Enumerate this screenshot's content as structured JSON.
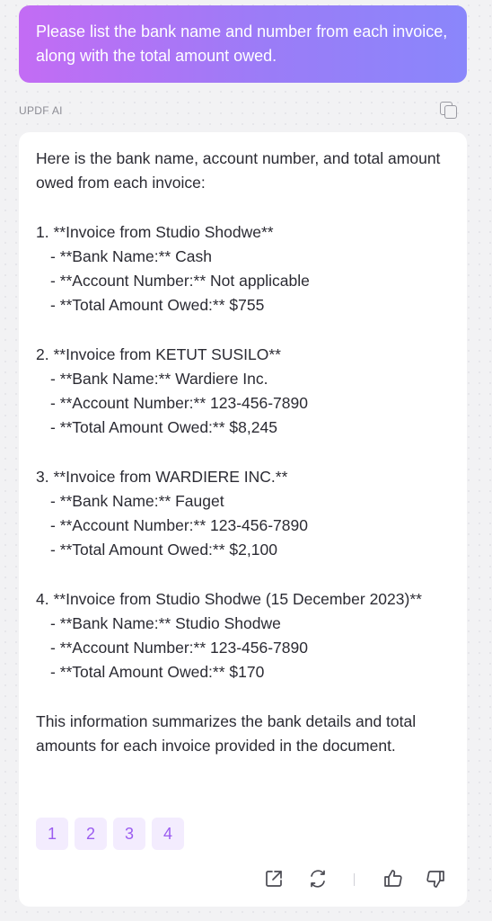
{
  "user_message": "Please list the bank name and number from each invoice, along with the total amount owed.",
  "ai_label": "UPDF AI",
  "answer": {
    "intro": "Here is the bank name, account number, and total amount owed from each invoice:",
    "items": [
      {
        "heading": "1. **Invoice from Studio Shodwe**",
        "lines": [
          "- **Bank Name:** Cash",
          "- **Account Number:** Not applicable",
          "- **Total Amount Owed:** $755"
        ]
      },
      {
        "heading": "2. **Invoice from KETUT SUSILO**",
        "lines": [
          "- **Bank Name:** Wardiere Inc.",
          "- **Account Number:** 123-456-7890",
          "- **Total Amount Owed:** $8,245"
        ]
      },
      {
        "heading": "3. **Invoice from WARDIERE INC.**",
        "lines": [
          "- **Bank Name:** Fauget",
          "- **Account Number:** 123-456-7890",
          "- **Total Amount Owed:** $2,100"
        ]
      },
      {
        "heading": "4. **Invoice from Studio Shodwe (15 December 2023)**",
        "lines": [
          "- **Bank Name:** Studio Shodwe",
          "- **Account Number:** 123-456-7890",
          "- **Total Amount Owed:** $170"
        ]
      }
    ],
    "summary": "This information summarizes the bank details and total amounts for each invoice provided in the document."
  },
  "references": [
    "1",
    "2",
    "3",
    "4"
  ],
  "icons": {
    "copy": "copy-icon",
    "export": "export-icon",
    "regenerate": "regenerate-icon",
    "like": "thumbs-up-icon",
    "dislike": "thumbs-down-icon"
  },
  "colors": {
    "gradient_start": "#c36cf4",
    "gradient_end": "#8a86fb",
    "chip_bg": "#f3ecfe",
    "chip_text": "#9b5cf0"
  }
}
